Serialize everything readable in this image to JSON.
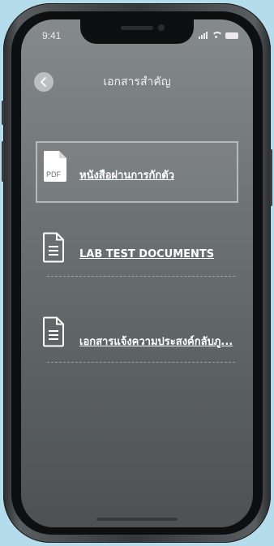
{
  "status_bar": {
    "time": "9:41"
  },
  "header": {
    "title": "เอกสารสำคัญ"
  },
  "documents": [
    {
      "label": "หนังสือผ่านการกักตัว",
      "icon": "pdf-file-icon",
      "icon_text": "PDF"
    },
    {
      "label": "LAB TEST DOCUMENTS",
      "icon": "document-icon"
    },
    {
      "label": "เอกสารแจ้งความประสงค์กลับภู...",
      "icon": "document-icon"
    }
  ]
}
